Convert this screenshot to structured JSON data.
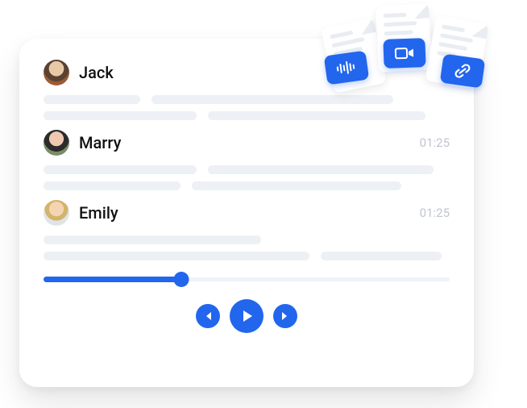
{
  "entries": [
    {
      "name": "Jack",
      "time": "",
      "avatar_class": "av-jack",
      "lines": [
        120,
        300,
        190,
        270
      ]
    },
    {
      "name": "Marry",
      "time": "01:25",
      "avatar_class": "av-marry",
      "lines": [
        190,
        280,
        170,
        260
      ]
    },
    {
      "name": "Emily",
      "time": "01:25",
      "avatar_class": "av-emily",
      "lines": [
        270,
        330,
        150
      ]
    }
  ],
  "player": {
    "progress_pct": 34
  },
  "badges": {
    "wave": "audio-wave-icon",
    "video": "video-icon",
    "link": "link-icon"
  }
}
